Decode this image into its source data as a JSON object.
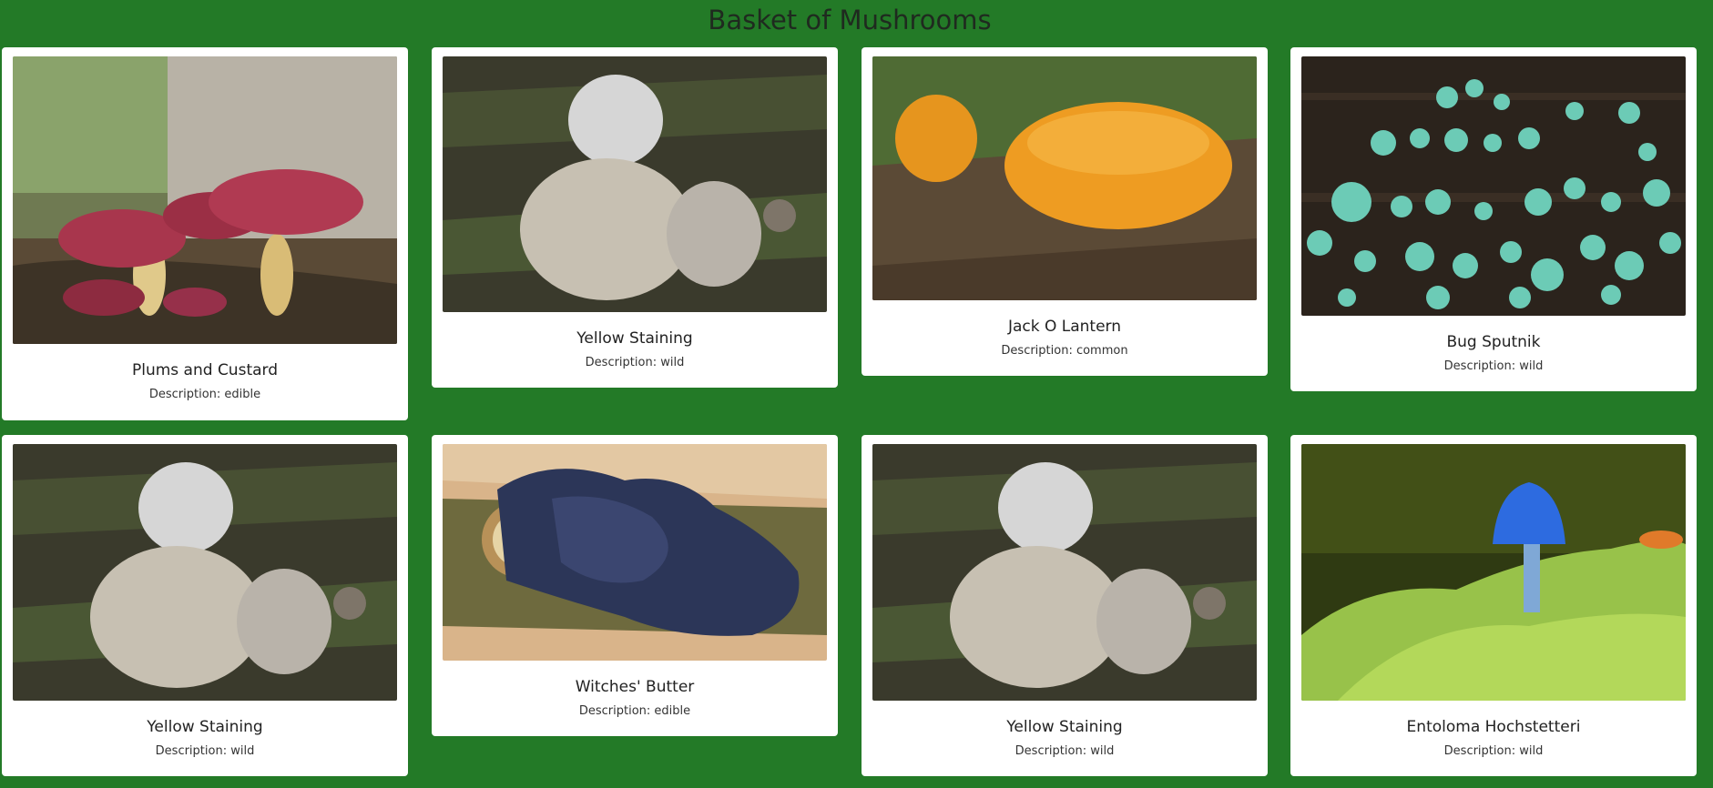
{
  "page": {
    "title": "Basket of Mushrooms",
    "background_color": "#237a27"
  },
  "cards": [
    {
      "name": "Plums and Custard",
      "description": "Description: edible",
      "image": "plums-and-custard-photo"
    },
    {
      "name": "Yellow Staining",
      "description": "Description: wild",
      "image": "yellow-staining-photo"
    },
    {
      "name": "Jack O Lantern",
      "description": "Description: common",
      "image": "jack-o-lantern-photo"
    },
    {
      "name": "Bug Sputnik",
      "description": "Description: wild",
      "image": "bug-sputnik-photo"
    },
    {
      "name": "Yellow Staining",
      "description": "Description: wild",
      "image": "yellow-staining-photo"
    },
    {
      "name": "Witches' Butter",
      "description": "Description: edible",
      "image": "witches-butter-photo"
    },
    {
      "name": "Yellow Staining",
      "description": "Description: wild",
      "image": "yellow-staining-photo"
    },
    {
      "name": "Entoloma Hochstetteri",
      "description": "Description: wild",
      "image": "entoloma-hochstetteri-photo"
    }
  ]
}
